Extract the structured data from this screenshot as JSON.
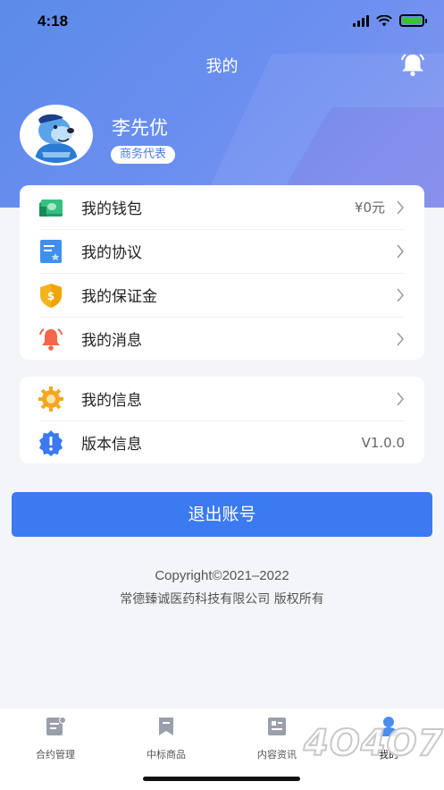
{
  "status_bar": {
    "time": "4:18"
  },
  "header": {
    "title": "我的"
  },
  "profile": {
    "name": "李先优",
    "role": "商务代表"
  },
  "menu_group1": [
    {
      "label": "我的钱包",
      "value": "¥0元",
      "icon": "wallet-icon"
    },
    {
      "label": "我的协议",
      "value": "",
      "icon": "agreement-icon"
    },
    {
      "label": "我的保证金",
      "value": "",
      "icon": "deposit-shield-icon"
    },
    {
      "label": "我的消息",
      "value": "",
      "icon": "bell-icon"
    }
  ],
  "menu_group2": [
    {
      "label": "我的信息",
      "value": "",
      "icon": "gear-icon"
    },
    {
      "label": "版本信息",
      "value": "V1.0.0",
      "icon": "info-badge-icon"
    }
  ],
  "logout_label": "退出账号",
  "footer": {
    "copyright": "Copyright©2021–2022",
    "company": "常德臻诚医药科技有限公司  版权所有"
  },
  "tabs": [
    {
      "label": "合约管理",
      "icon": "contract-icon",
      "active": false
    },
    {
      "label": "中标商品",
      "icon": "bookmark-icon",
      "active": false
    },
    {
      "label": "内容资讯",
      "icon": "news-icon",
      "active": false
    },
    {
      "label": "我的",
      "icon": "user-icon",
      "active": true
    }
  ],
  "watermark": "4O4O7",
  "colors": {
    "primary": "#3b7af0",
    "header_start": "#5b8bea",
    "header_end": "#8597ee"
  }
}
